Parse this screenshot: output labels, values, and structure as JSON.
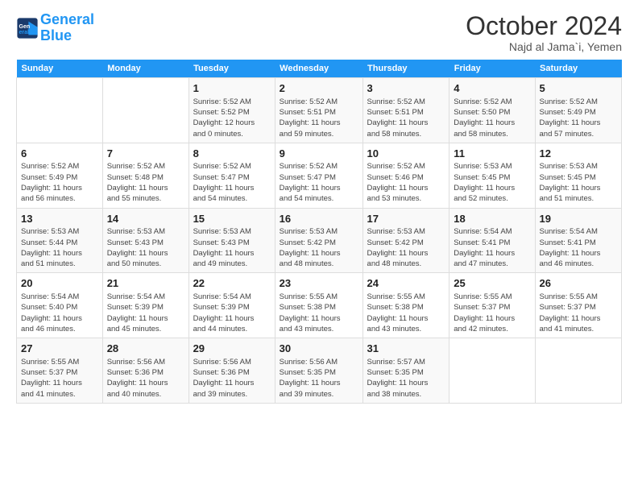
{
  "header": {
    "logo_line1": "General",
    "logo_line2": "Blue",
    "month": "October 2024",
    "location": "Najd al Jama`i, Yemen"
  },
  "weekdays": [
    "Sunday",
    "Monday",
    "Tuesday",
    "Wednesday",
    "Thursday",
    "Friday",
    "Saturday"
  ],
  "weeks": [
    [
      {
        "day": "",
        "info": ""
      },
      {
        "day": "",
        "info": ""
      },
      {
        "day": "1",
        "info": "Sunrise: 5:52 AM\nSunset: 5:52 PM\nDaylight: 12 hours\nand 0 minutes."
      },
      {
        "day": "2",
        "info": "Sunrise: 5:52 AM\nSunset: 5:51 PM\nDaylight: 11 hours\nand 59 minutes."
      },
      {
        "day": "3",
        "info": "Sunrise: 5:52 AM\nSunset: 5:51 PM\nDaylight: 11 hours\nand 58 minutes."
      },
      {
        "day": "4",
        "info": "Sunrise: 5:52 AM\nSunset: 5:50 PM\nDaylight: 11 hours\nand 58 minutes."
      },
      {
        "day": "5",
        "info": "Sunrise: 5:52 AM\nSunset: 5:49 PM\nDaylight: 11 hours\nand 57 minutes."
      }
    ],
    [
      {
        "day": "6",
        "info": "Sunrise: 5:52 AM\nSunset: 5:49 PM\nDaylight: 11 hours\nand 56 minutes."
      },
      {
        "day": "7",
        "info": "Sunrise: 5:52 AM\nSunset: 5:48 PM\nDaylight: 11 hours\nand 55 minutes."
      },
      {
        "day": "8",
        "info": "Sunrise: 5:52 AM\nSunset: 5:47 PM\nDaylight: 11 hours\nand 54 minutes."
      },
      {
        "day": "9",
        "info": "Sunrise: 5:52 AM\nSunset: 5:47 PM\nDaylight: 11 hours\nand 54 minutes."
      },
      {
        "day": "10",
        "info": "Sunrise: 5:52 AM\nSunset: 5:46 PM\nDaylight: 11 hours\nand 53 minutes."
      },
      {
        "day": "11",
        "info": "Sunrise: 5:53 AM\nSunset: 5:45 PM\nDaylight: 11 hours\nand 52 minutes."
      },
      {
        "day": "12",
        "info": "Sunrise: 5:53 AM\nSunset: 5:45 PM\nDaylight: 11 hours\nand 51 minutes."
      }
    ],
    [
      {
        "day": "13",
        "info": "Sunrise: 5:53 AM\nSunset: 5:44 PM\nDaylight: 11 hours\nand 51 minutes."
      },
      {
        "day": "14",
        "info": "Sunrise: 5:53 AM\nSunset: 5:43 PM\nDaylight: 11 hours\nand 50 minutes."
      },
      {
        "day": "15",
        "info": "Sunrise: 5:53 AM\nSunset: 5:43 PM\nDaylight: 11 hours\nand 49 minutes."
      },
      {
        "day": "16",
        "info": "Sunrise: 5:53 AM\nSunset: 5:42 PM\nDaylight: 11 hours\nand 48 minutes."
      },
      {
        "day": "17",
        "info": "Sunrise: 5:53 AM\nSunset: 5:42 PM\nDaylight: 11 hours\nand 48 minutes."
      },
      {
        "day": "18",
        "info": "Sunrise: 5:54 AM\nSunset: 5:41 PM\nDaylight: 11 hours\nand 47 minutes."
      },
      {
        "day": "19",
        "info": "Sunrise: 5:54 AM\nSunset: 5:41 PM\nDaylight: 11 hours\nand 46 minutes."
      }
    ],
    [
      {
        "day": "20",
        "info": "Sunrise: 5:54 AM\nSunset: 5:40 PM\nDaylight: 11 hours\nand 46 minutes."
      },
      {
        "day": "21",
        "info": "Sunrise: 5:54 AM\nSunset: 5:39 PM\nDaylight: 11 hours\nand 45 minutes."
      },
      {
        "day": "22",
        "info": "Sunrise: 5:54 AM\nSunset: 5:39 PM\nDaylight: 11 hours\nand 44 minutes."
      },
      {
        "day": "23",
        "info": "Sunrise: 5:55 AM\nSunset: 5:38 PM\nDaylight: 11 hours\nand 43 minutes."
      },
      {
        "day": "24",
        "info": "Sunrise: 5:55 AM\nSunset: 5:38 PM\nDaylight: 11 hours\nand 43 minutes."
      },
      {
        "day": "25",
        "info": "Sunrise: 5:55 AM\nSunset: 5:37 PM\nDaylight: 11 hours\nand 42 minutes."
      },
      {
        "day": "26",
        "info": "Sunrise: 5:55 AM\nSunset: 5:37 PM\nDaylight: 11 hours\nand 41 minutes."
      }
    ],
    [
      {
        "day": "27",
        "info": "Sunrise: 5:55 AM\nSunset: 5:37 PM\nDaylight: 11 hours\nand 41 minutes."
      },
      {
        "day": "28",
        "info": "Sunrise: 5:56 AM\nSunset: 5:36 PM\nDaylight: 11 hours\nand 40 minutes."
      },
      {
        "day": "29",
        "info": "Sunrise: 5:56 AM\nSunset: 5:36 PM\nDaylight: 11 hours\nand 39 minutes."
      },
      {
        "day": "30",
        "info": "Sunrise: 5:56 AM\nSunset: 5:35 PM\nDaylight: 11 hours\nand 39 minutes."
      },
      {
        "day": "31",
        "info": "Sunrise: 5:57 AM\nSunset: 5:35 PM\nDaylight: 11 hours\nand 38 minutes."
      },
      {
        "day": "",
        "info": ""
      },
      {
        "day": "",
        "info": ""
      }
    ]
  ]
}
